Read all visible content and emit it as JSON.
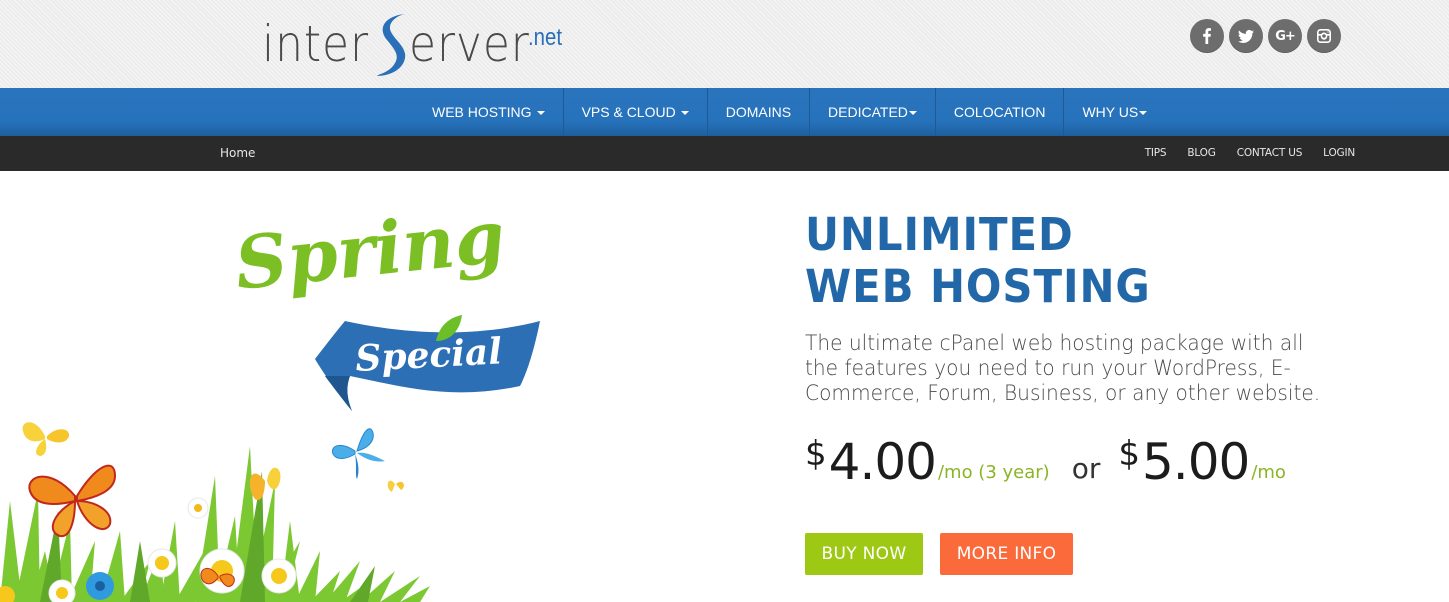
{
  "brand": {
    "logo_text_1": "inter",
    "logo_text_2": "erver",
    "logo_suffix": ".net",
    "logo_s_color": "#2a6fb8"
  },
  "social": [
    {
      "name": "facebook",
      "label": "f"
    },
    {
      "name": "twitter",
      "label": ""
    },
    {
      "name": "google-plus",
      "label": "G+"
    },
    {
      "name": "instagram",
      "label": ""
    }
  ],
  "main_nav": [
    {
      "label": "WEB HOSTING",
      "dropdown": true
    },
    {
      "label": "VPS & CLOUD",
      "dropdown": true
    },
    {
      "label": "DOMAINS",
      "dropdown": false
    },
    {
      "label": "DEDICATED",
      "dropdown": true
    },
    {
      "label": "COLOCATION",
      "dropdown": false
    },
    {
      "label": "WHY US",
      "dropdown": true
    }
  ],
  "sub_nav": {
    "breadcrumb": "Home",
    "links": [
      "TIPS",
      "BLOG",
      "CONTACT US",
      "LOGIN"
    ]
  },
  "hero": {
    "promo_title": "Spring",
    "promo_subtitle": "Special",
    "title_line1": "UNLIMITED",
    "title_line2": "WEB HOSTING",
    "description": "The ultimate cPanel web hosting package with all the features you need to run your WordPress, E-Commerce, Forum, Business, or any other website.",
    "price1": {
      "currency": "$",
      "amount": "4.00",
      "period": "/mo (3 year)"
    },
    "or_label": "or",
    "price2": {
      "currency": "$",
      "amount": "5.00",
      "period": "/mo"
    },
    "buy_label": "BUY NOW",
    "info_label": "MORE INFO"
  },
  "colors": {
    "nav_blue": "#2672bb",
    "subnav_dark": "#2a2a2a",
    "title_blue": "#2267a8",
    "price_green": "#8ab526",
    "buy_green": "#9dc814",
    "info_orange": "#fb6a3b",
    "promo_green": "#7cbf24"
  }
}
